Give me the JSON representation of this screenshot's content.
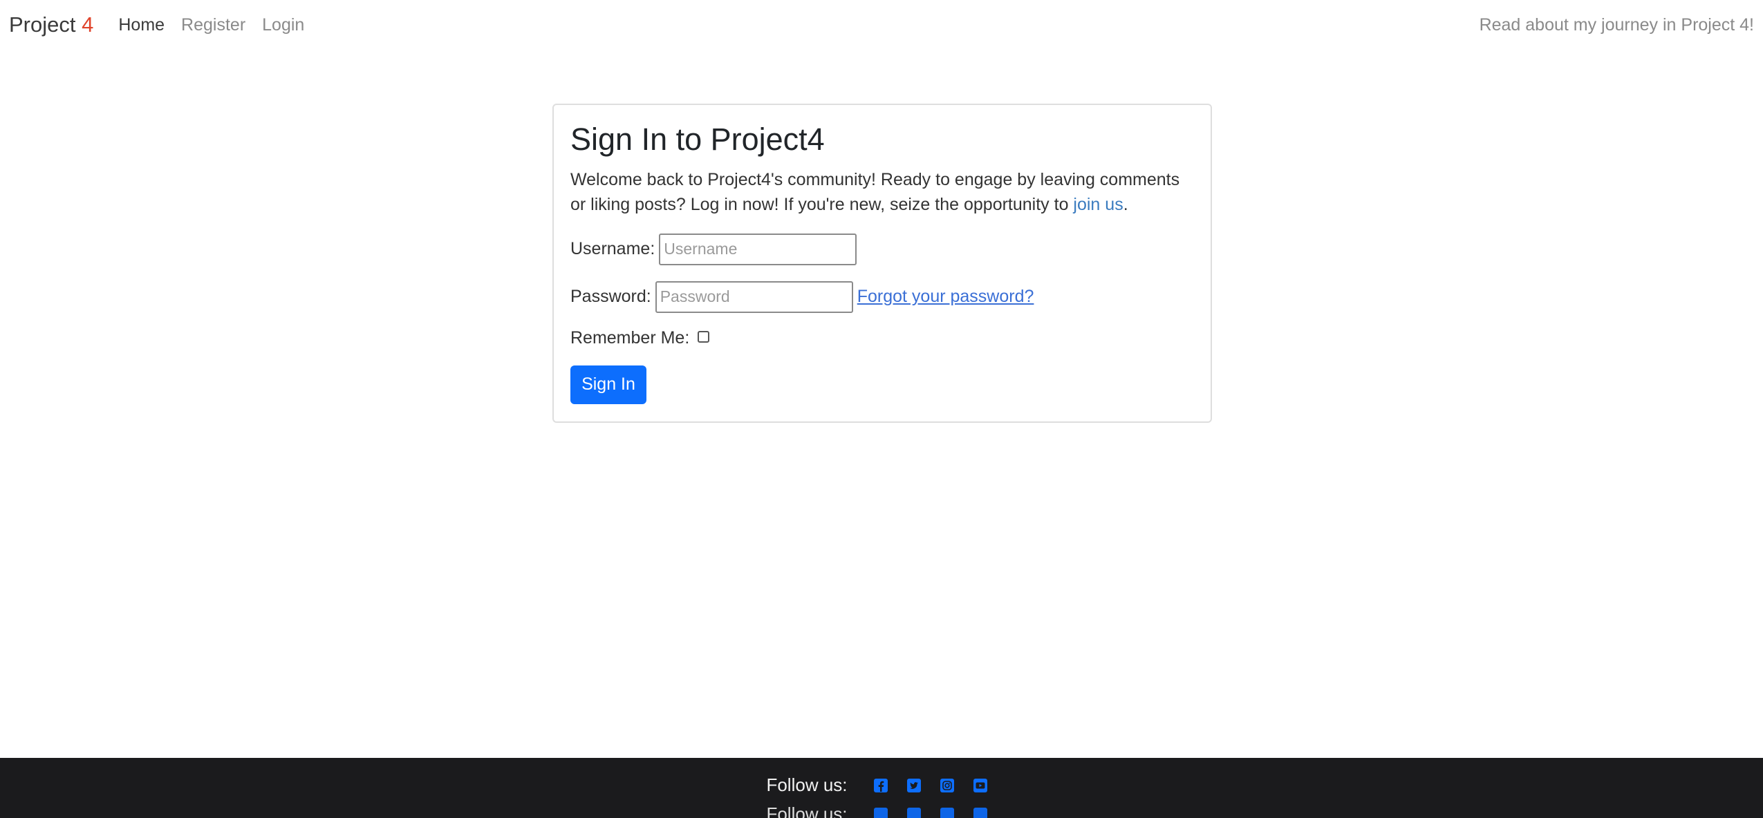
{
  "navbar": {
    "brand_text": "Project",
    "brand_accent": "4",
    "links": [
      {
        "label": "Home",
        "active": true
      },
      {
        "label": "Register",
        "active": false
      },
      {
        "label": "Login",
        "active": false
      }
    ],
    "right_link": "Read about my journey in Project 4!"
  },
  "signin": {
    "title": "Sign In to Project4",
    "intro_text": "Welcome back to Project4's community! Ready to engage by leaving comments or liking posts? Log in now! If you're new, seize the opportunity to ",
    "join_link": "join us",
    "intro_end": ".",
    "username_label": "Username:",
    "username_placeholder": "Username",
    "username_value": "",
    "password_label": "Password:",
    "password_placeholder": "Password",
    "password_value": "",
    "forgot_link": "Forgot your password?",
    "remember_label": "Remember Me:",
    "remember_checked": false,
    "submit_label": "Sign In"
  },
  "footer": {
    "follow_label": "Follow us:",
    "icons": [
      "facebook-icon",
      "twitter-icon",
      "instagram-icon",
      "youtube-icon"
    ]
  },
  "colors": {
    "brand_accent": "#e0442c",
    "primary": "#0d6efd",
    "footer_bg": "#1b1b1d",
    "link": "#3a7bbf"
  }
}
